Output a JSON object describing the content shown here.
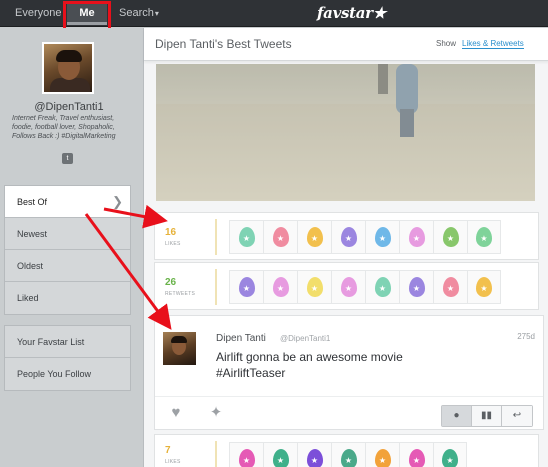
{
  "topbar": {
    "everyone": "Everyone",
    "me": "Me",
    "search": "Search",
    "search_caret": "▾",
    "logo": "favstar★"
  },
  "profile": {
    "handle": "@DipenTanti1",
    "bio": "Internet Freak, Travel enthusiast, foodie, football lover, Shopaholic, Follows Back :) #DigitalMarketing",
    "twitter_icon": "t"
  },
  "menu_primary": [
    {
      "label": "Best Of",
      "active": true
    },
    {
      "label": "Newest"
    },
    {
      "label": "Oldest"
    },
    {
      "label": "Liked"
    }
  ],
  "menu_secondary": [
    {
      "label": "Your Favstar List"
    },
    {
      "label": "People You Follow"
    }
  ],
  "main": {
    "title": "Dipen Tanti's Best Tweets",
    "show_label": "Show",
    "show_link": "Likes & Retweets"
  },
  "likes_row": {
    "count": "16",
    "label": "LIKES",
    "color": "#e6b23a",
    "egg_colors": [
      "#7fd3b4",
      "#f08ca0",
      "#f2c04d",
      "#9b86e0",
      "#6fb8e8",
      "#e79be0",
      "#88c76b",
      "#7fd39a"
    ]
  },
  "retweets_row": {
    "count": "26",
    "label": "RETWEETS",
    "color": "#69b34a",
    "egg_colors": [
      "#9b86e0",
      "#e79be0",
      "#f2de6b",
      "#e79be0",
      "#7fd3b4",
      "#9b86e0",
      "#f08ca0",
      "#f2c04d"
    ]
  },
  "tweet": {
    "name": "Dipen Tanti",
    "handle": "@DipenTanti1",
    "age": "275d",
    "text_line1": "Airlift gonna be an awesome movie",
    "text_line2": "#AirliftTeaser",
    "heart_icon": "♥",
    "pin_icon": "✦",
    "toggle_person": "●",
    "toggle_chart": "▮▮",
    "toggle_reply": "↩"
  },
  "likes_row_2": {
    "count": "7",
    "label": "LIKES",
    "color": "#e6b23a",
    "egg_colors": [
      "#e55ab5",
      "#3fb08a",
      "#7c4fd9",
      "#4aa98a",
      "#f2a23a",
      "#e55ab5",
      "#3fb08a"
    ]
  },
  "colors": {
    "annotation_red": "#e8101b",
    "link_blue": "#2a8fcc"
  }
}
